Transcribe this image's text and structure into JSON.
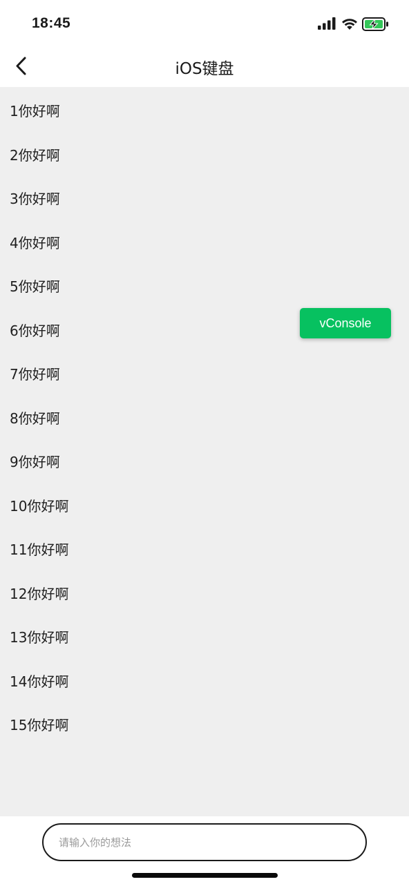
{
  "status_bar": {
    "time": "18:45",
    "icons": [
      "signal-icon",
      "wifi-icon",
      "battery-charging-icon"
    ],
    "battery_color": "#34c759"
  },
  "nav": {
    "title": "iOS键盘",
    "back_icon": "chevron-left-icon"
  },
  "list": {
    "items": [
      "1你好啊",
      "2你好啊",
      "3你好啊",
      "4你好啊",
      "5你好啊",
      "6你好啊",
      "7你好啊",
      "8你好啊",
      "9你好啊",
      "10你好啊",
      "11你好啊",
      "12你好啊",
      "13你好啊",
      "14你好啊",
      "15你好啊"
    ]
  },
  "vconsole": {
    "label": "vConsole",
    "color": "#07c160"
  },
  "input": {
    "placeholder": "请输入你的想法",
    "value": ""
  }
}
